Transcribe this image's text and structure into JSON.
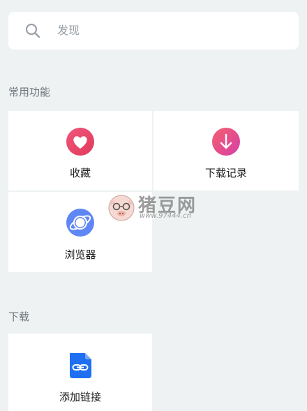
{
  "search": {
    "placeholder": "发现",
    "icon": "search-icon"
  },
  "sections": [
    {
      "title": "常用功能",
      "items": [
        {
          "label": "收藏",
          "icon": "heart-icon",
          "color": "#ec4a6a"
        },
        {
          "label": "下载记录",
          "icon": "download-icon",
          "color": "#f14a8a"
        },
        {
          "label": "浏览器",
          "icon": "planet-icon",
          "color": "#5f86f5"
        }
      ]
    },
    {
      "title": "下载",
      "items": [
        {
          "label": "添加链接",
          "icon": "link-file-icon",
          "color": "#1e6ff2"
        }
      ]
    }
  ],
  "watermark": {
    "title": "猪豆网",
    "url": "www.97444.cn"
  }
}
